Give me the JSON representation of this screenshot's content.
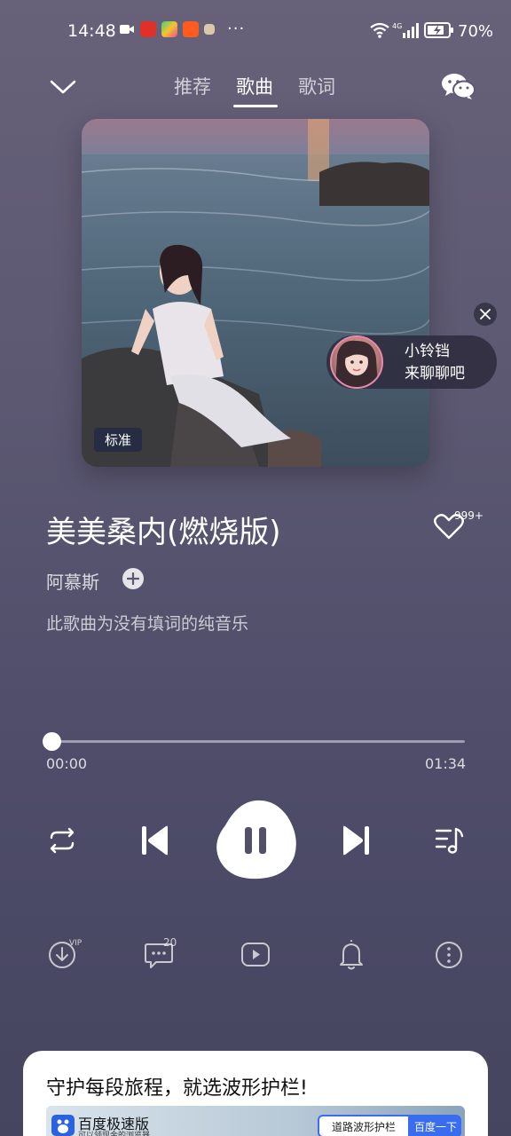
{
  "status_bar": {
    "time": "14:48",
    "more": "···",
    "battery_percent": "70%",
    "network": "4G"
  },
  "header": {
    "tabs": [
      {
        "label": "推荐",
        "active": false
      },
      {
        "label": "歌曲",
        "active": true
      },
      {
        "label": "歌词",
        "active": false
      }
    ]
  },
  "album": {
    "quality_badge": "标准"
  },
  "chat_bubble": {
    "line1": "小铃铛",
    "line2": "来聊聊吧"
  },
  "song": {
    "title": "美美桑内(燃烧版)",
    "artist": "阿慕斯",
    "like_count": "999+",
    "lyrics_note": "此歌曲为没有填词的纯音乐"
  },
  "progress": {
    "current": "00:00",
    "total": "01:34",
    "fraction": 0.0
  },
  "actions": {
    "download_badge": "VIP",
    "comment_count": "20"
  },
  "ad": {
    "title": "守护每段旅程，就选波形护栏!",
    "brand": "百度极速版",
    "brand_sub": "可以领现金的浏览器",
    "search_text": "道路波形护栏",
    "search_button": "百度一下"
  },
  "colors": {
    "background_top": "#676179",
    "background_bottom": "#45455f",
    "accent": "#ffffff",
    "ad_button": "#3a6cf0"
  }
}
